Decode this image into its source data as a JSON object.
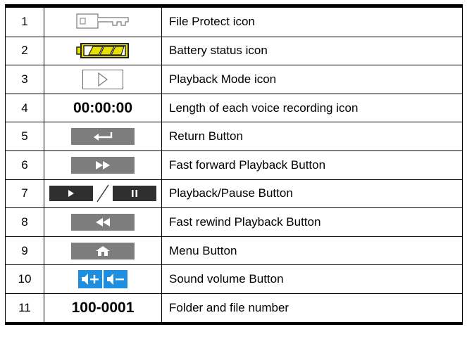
{
  "rows": [
    {
      "num": "1",
      "desc": "File Protect icon",
      "icon": "key-icon"
    },
    {
      "num": "2",
      "desc": "Battery status icon",
      "icon": "battery-icon"
    },
    {
      "num": "3",
      "desc": "Playback Mode icon",
      "icon": "play-outline-icon"
    },
    {
      "num": "4",
      "desc": "Length of each voice recording icon",
      "icon_text": "00:00:00"
    },
    {
      "num": "5",
      "desc": "Return Button",
      "icon": "return-icon"
    },
    {
      "num": "6",
      "desc": "Fast forward Playback Button",
      "icon": "fast-forward-icon"
    },
    {
      "num": "7",
      "desc": "Playback/Pause Button",
      "icon": "play-pause-icon"
    },
    {
      "num": "8",
      "desc": "Fast rewind Playback Button",
      "icon": "fast-rewind-icon"
    },
    {
      "num": "9",
      "desc": "Menu Button",
      "icon": "home-icon"
    },
    {
      "num": "10",
      "desc": "Sound volume Button",
      "icon": "volume-up-down-icon"
    },
    {
      "num": "11",
      "desc": "Folder and file number",
      "icon_text": "100-0001"
    }
  ],
  "colors": {
    "button_gray": "#7d7d7d",
    "button_dark": "#2f2f2f",
    "volume_blue": "#1e8fe0",
    "battery_yellow": "#e8e000"
  }
}
